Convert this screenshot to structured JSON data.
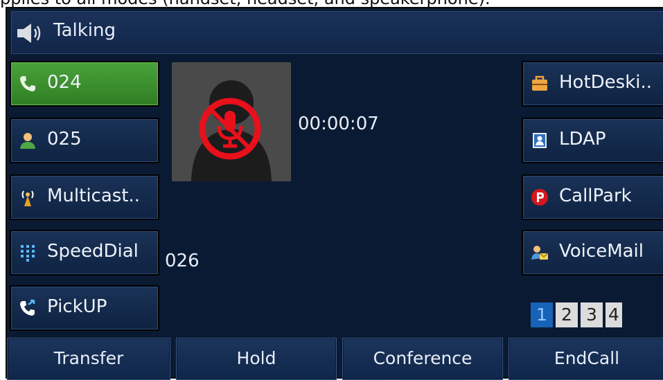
{
  "caption": "pplies to all modes (handset, headset, and speakerphone).",
  "title": "Talking",
  "call": {
    "timer": "00:00:07",
    "number": "026"
  },
  "left_keys": [
    {
      "label": "024"
    },
    {
      "label": "025"
    },
    {
      "label": "Multicast.."
    },
    {
      "label": "SpeedDial"
    },
    {
      "label": "PickUP"
    }
  ],
  "right_keys": [
    {
      "label": "HotDeski.."
    },
    {
      "label": "LDAP"
    },
    {
      "label": "CallPark"
    },
    {
      "label": "VoiceMail"
    }
  ],
  "pages": [
    "1",
    "2",
    "3",
    "4"
  ],
  "softkeys": [
    "Transfer",
    "Hold",
    "Conference",
    "EndCall"
  ],
  "colors": {
    "active_key": "#3f9a33",
    "background": "#0b1a33",
    "mute": "#e8101b",
    "page_active": "#1763b8"
  }
}
